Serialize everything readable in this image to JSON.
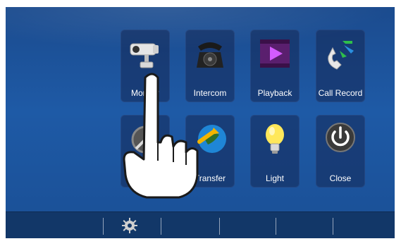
{
  "tiles": {
    "monitor": {
      "label": "Monitor",
      "icon": "security-camera-icon"
    },
    "intercom": {
      "label": "Intercom",
      "icon": "rotary-phone-icon"
    },
    "playback": {
      "label": "Playback",
      "icon": "video-play-icon"
    },
    "call_record": {
      "label": "Call Record",
      "icon": "call-log-icon"
    },
    "do_not_disturb": {
      "label_line1": "Do Not",
      "label_line2": "Disrupt",
      "icon": "do-not-disturb-icon"
    },
    "transfer": {
      "label": "Transfer",
      "icon": "transfer-globe-icon"
    },
    "light": {
      "label": "Light",
      "icon": "light-bulb-icon"
    },
    "close": {
      "label": "Close",
      "icon": "power-icon"
    }
  },
  "bottombar": {
    "settings_icon": "gear-icon"
  },
  "colors": {
    "background": "#1e5aa6",
    "tile": "#142855",
    "bottombar": "#123768",
    "text": "#ffffff"
  }
}
